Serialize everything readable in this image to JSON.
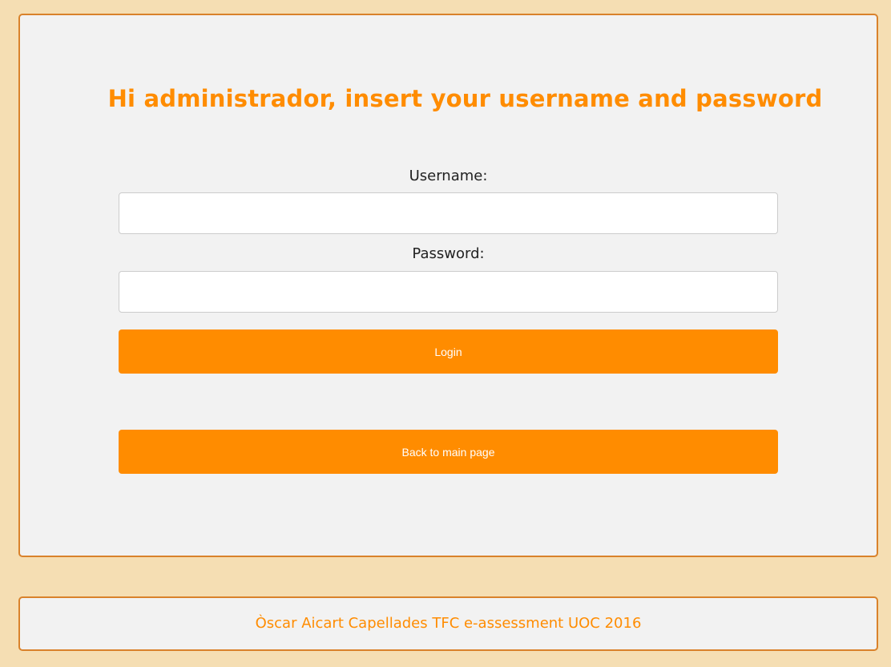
{
  "main": {
    "title": "Hi administrador, insert your username and password",
    "username_label": "Username:",
    "username_value": "",
    "password_label": "Password:",
    "password_value": "",
    "login_label": "Login",
    "back_label": "Back to main page"
  },
  "footer": {
    "text": "Òscar Aicart Capellades TFC e-assessment UOC 2016"
  },
  "colors": {
    "background": "#f5deb3",
    "panel": "#f2f2f2",
    "border": "#d9822b",
    "accent": "#ff8c00"
  }
}
